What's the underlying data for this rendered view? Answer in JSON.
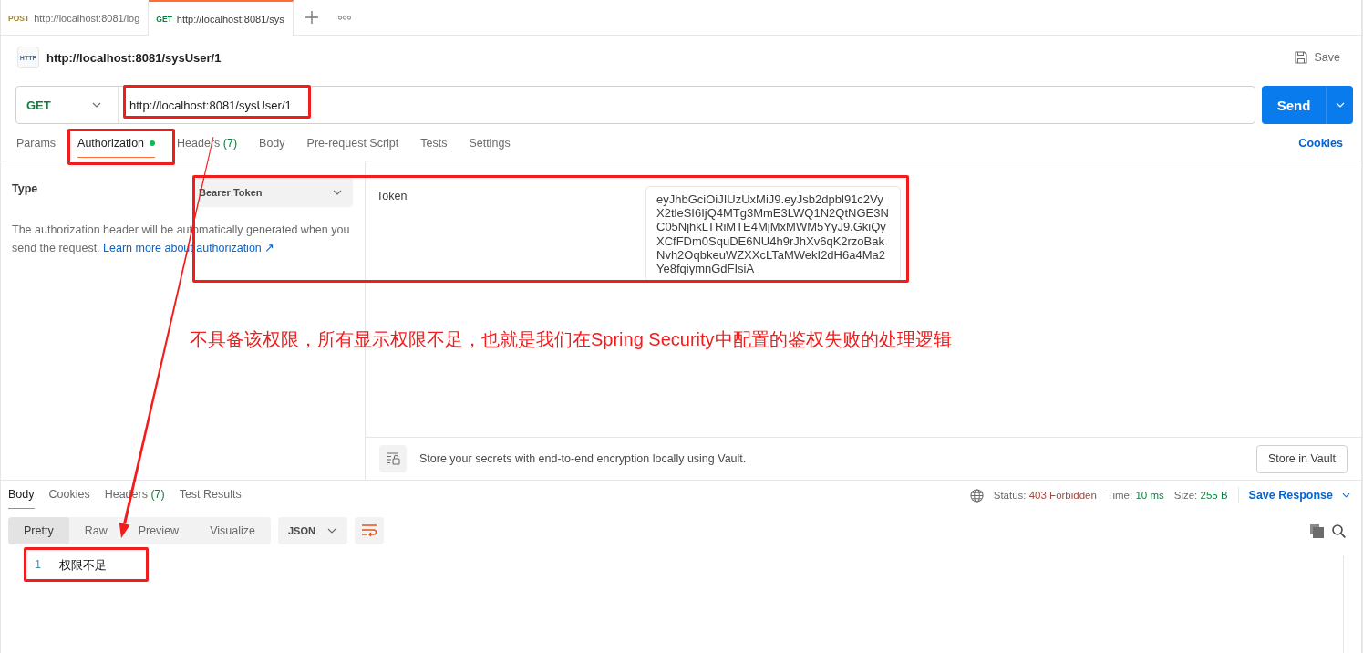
{
  "tabs": [
    {
      "method": "POST",
      "color": "#a4812f",
      "url": "http://localhost:8081/log",
      "selected": false
    },
    {
      "method": "GET",
      "color": "#0f7d3f",
      "url": "http://localhost:8081/sys",
      "selected": true
    }
  ],
  "request": {
    "badge": "HTTP",
    "title": "http://localhost:8081/sysUser/1",
    "save_label": "Save",
    "method": "GET",
    "url": "http://localhost:8081/sysUser/1",
    "url_highlighted": true,
    "send_label": "Send"
  },
  "request_tabs": [
    {
      "label": "Params",
      "selected": false,
      "dot": false,
      "highlighted": false
    },
    {
      "label": "Authorization",
      "selected": true,
      "dot": true,
      "highlighted": true
    },
    {
      "label": "Headers",
      "count": "(7)",
      "selected": false,
      "dot": false,
      "highlighted": false
    },
    {
      "label": "Body",
      "selected": false,
      "dot": false,
      "highlighted": false
    },
    {
      "label": "Pre-request Script",
      "selected": false,
      "dot": false,
      "highlighted": false
    },
    {
      "label": "Tests",
      "selected": false,
      "dot": false,
      "highlighted": false
    },
    {
      "label": "Settings",
      "selected": false,
      "dot": false,
      "highlighted": false
    }
  ],
  "cookies_link": "Cookies",
  "authorization": {
    "type_label": "Type",
    "type_value": "Bearer Token",
    "description": "The authorization header will be automatically generated when you send the request.",
    "link": "Learn more about authorization ↗",
    "token_label": "Token",
    "token": "eyJhbGciOiJIUzUxMiJ9.eyJsb2dpbl91c2VyX2tleSI6IjQ4MTg3MmE3LWQ1N2QtNGE3NC05NjhkLTRiMTE4MjMxMWM5YyJ9.GkiQyXCfFDm0SquDE6NU4h9rJhXv6qK2rzoBakNvh2OqbkeuWZXXcLTaMWekI2dH6a4Ma2Ye8fqiymnGdFIsiA",
    "highlighted": true
  },
  "annotation": {
    "note": "不具备该权限，所有显示权限不足，也就是我们在Spring Security中配置的鉴权失败的处理逻辑",
    "arrow": true
  },
  "vault": {
    "message": "Store your secrets with end-to-end encryption locally using Vault.",
    "button": "Store in Vault"
  },
  "response": {
    "tabs": [
      {
        "label": "Body",
        "selected": true
      },
      {
        "label": "Cookies",
        "selected": false
      },
      {
        "label": "Headers",
        "count": "(7)",
        "selected": false
      },
      {
        "label": "Test Results",
        "selected": false
      }
    ],
    "status_label": "Status:",
    "status": "403 Forbidden",
    "time_label": "Time:",
    "time": "10 ms",
    "size_label": "Size:",
    "size": "255 B",
    "save_response": "Save Response",
    "views": [
      {
        "label": "Pretty",
        "selected": true
      },
      {
        "label": "Raw",
        "selected": false
      },
      {
        "label": "Preview",
        "selected": false
      },
      {
        "label": "Visualize",
        "selected": false
      }
    ],
    "format": "JSON",
    "lines": [
      {
        "number": "1",
        "text": "权限不足",
        "highlighted": true
      }
    ]
  }
}
